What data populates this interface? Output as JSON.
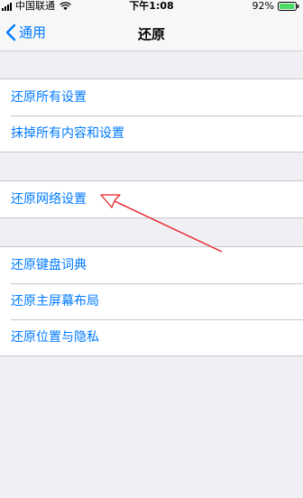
{
  "status_bar": {
    "carrier": "中国联通",
    "time": "下午1:08",
    "battery": "92%"
  },
  "nav": {
    "back_label": "通用",
    "title": "还原"
  },
  "groups": [
    {
      "items": [
        "还原所有设置",
        "抹掉所有内容和设置"
      ]
    },
    {
      "items": [
        "还原网络设置"
      ]
    },
    {
      "items": [
        "还原键盘词典",
        "还原主屏幕布局",
        "还原位置与隐私"
      ]
    }
  ],
  "colors": {
    "accent": "#007aff",
    "background": "#efeff4",
    "annotation": "#e8222a"
  },
  "annotation": {
    "type": "arrow",
    "target": "还原网络设置"
  }
}
